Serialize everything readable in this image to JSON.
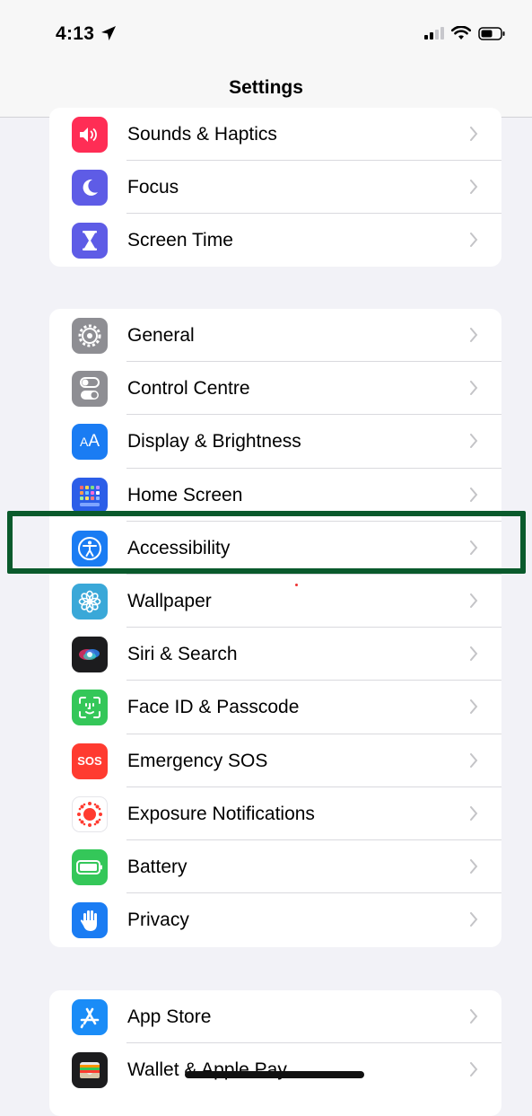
{
  "status": {
    "time": "4:13"
  },
  "nav": {
    "title": "Settings"
  },
  "group1": [
    {
      "label": "Sounds & Haptics",
      "icon": "speaker-icon",
      "color": "#ff2d55"
    },
    {
      "label": "Focus",
      "icon": "moon-icon",
      "color": "#5e5ce6"
    },
    {
      "label": "Screen Time",
      "icon": "hourglass-icon",
      "color": "#5e5ce6"
    }
  ],
  "group2": [
    {
      "label": "General",
      "icon": "gear-icon",
      "color": "#8e8e93"
    },
    {
      "label": "Control Centre",
      "icon": "toggles-icon",
      "color": "#8e8e93"
    },
    {
      "label": "Display & Brightness",
      "icon": "aa-icon",
      "color": "#1a7cf3"
    },
    {
      "label": "Home Screen",
      "icon": "grid-icon",
      "color": "#2c5ee8"
    },
    {
      "label": "Accessibility",
      "icon": "accessibility-icon",
      "color": "#1a7cf3"
    },
    {
      "label": "Wallpaper",
      "icon": "flower-icon",
      "color": "#3aa8d8"
    },
    {
      "label": "Siri & Search",
      "icon": "siri-icon",
      "color": "#1c1c1e"
    },
    {
      "label": "Face ID & Passcode",
      "icon": "face-id-icon",
      "color": "#34c759"
    },
    {
      "label": "Emergency SOS",
      "icon": "sos-icon",
      "color": "#ff3b30",
      "icon_text": "SOS"
    },
    {
      "label": "Exposure Notifications",
      "icon": "exposure-icon",
      "color": "#ffffff"
    },
    {
      "label": "Battery",
      "icon": "battery-icon",
      "color": "#34c759"
    },
    {
      "label": "Privacy",
      "icon": "hand-icon",
      "color": "#1a7cf3"
    }
  ],
  "group3": [
    {
      "label": "App Store",
      "icon": "app-store-icon",
      "color": "#1a8cf7"
    },
    {
      "label": "Wallet & Apple Pay",
      "icon": "wallet-icon",
      "color": "#1c1c1e"
    }
  ]
}
